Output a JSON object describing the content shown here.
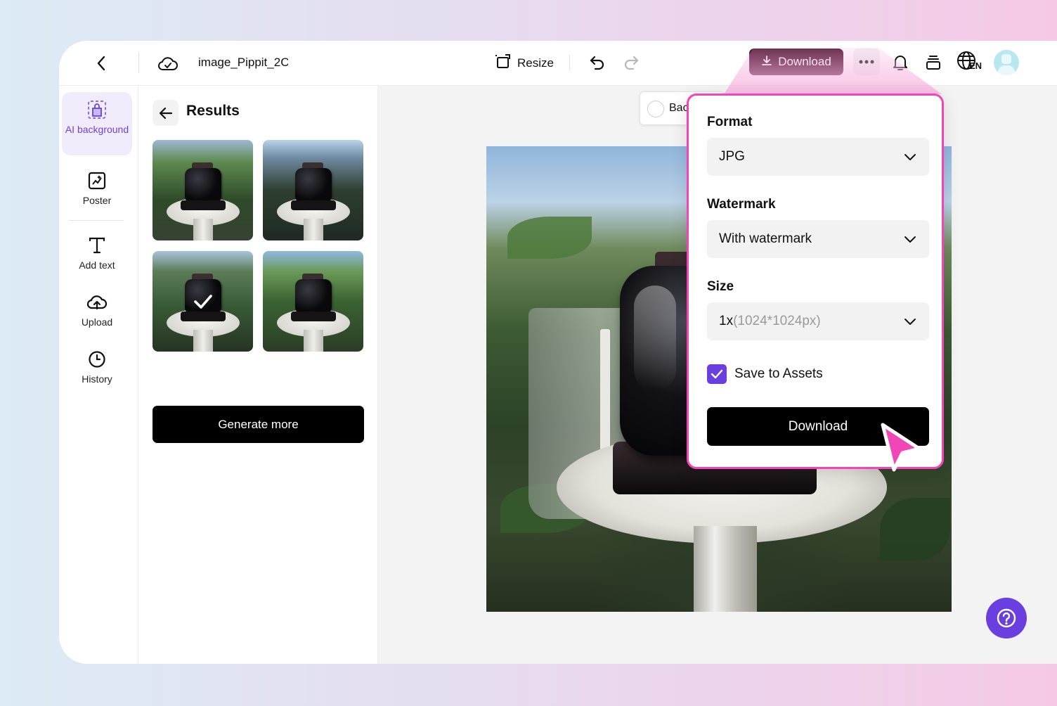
{
  "header": {
    "file_name": "image_Pippit_2C",
    "resize_label": "Resize",
    "download_label": "Download",
    "language_code": "EN"
  },
  "sidebar": {
    "items": [
      {
        "label": "AI background",
        "icon": "ai-background-icon",
        "active": true
      },
      {
        "label": "Poster",
        "icon": "poster-icon"
      },
      {
        "label": "Add text",
        "icon": "text-icon"
      },
      {
        "label": "Upload",
        "icon": "upload-cloud-icon"
      },
      {
        "label": "History",
        "icon": "clock-icon"
      }
    ]
  },
  "results": {
    "title": "Results",
    "generate_more_label": "Generate more",
    "selected_index": 2
  },
  "canvas": {
    "background_toggle_label": "Bac"
  },
  "download_panel": {
    "format_label": "Format",
    "format_value": "JPG",
    "watermark_label": "Watermark",
    "watermark_value": "With watermark",
    "size_label": "Size",
    "size_value_main": "1x",
    "size_value_detail": "(1024*1024px)",
    "save_to_assets_label": "Save to Assets",
    "save_to_assets_checked": true,
    "download_button_label": "Download"
  },
  "colors": {
    "accent": "#6a3fe0",
    "highlight": "#f046b8",
    "download_button_bg": "#4a0f2b"
  }
}
